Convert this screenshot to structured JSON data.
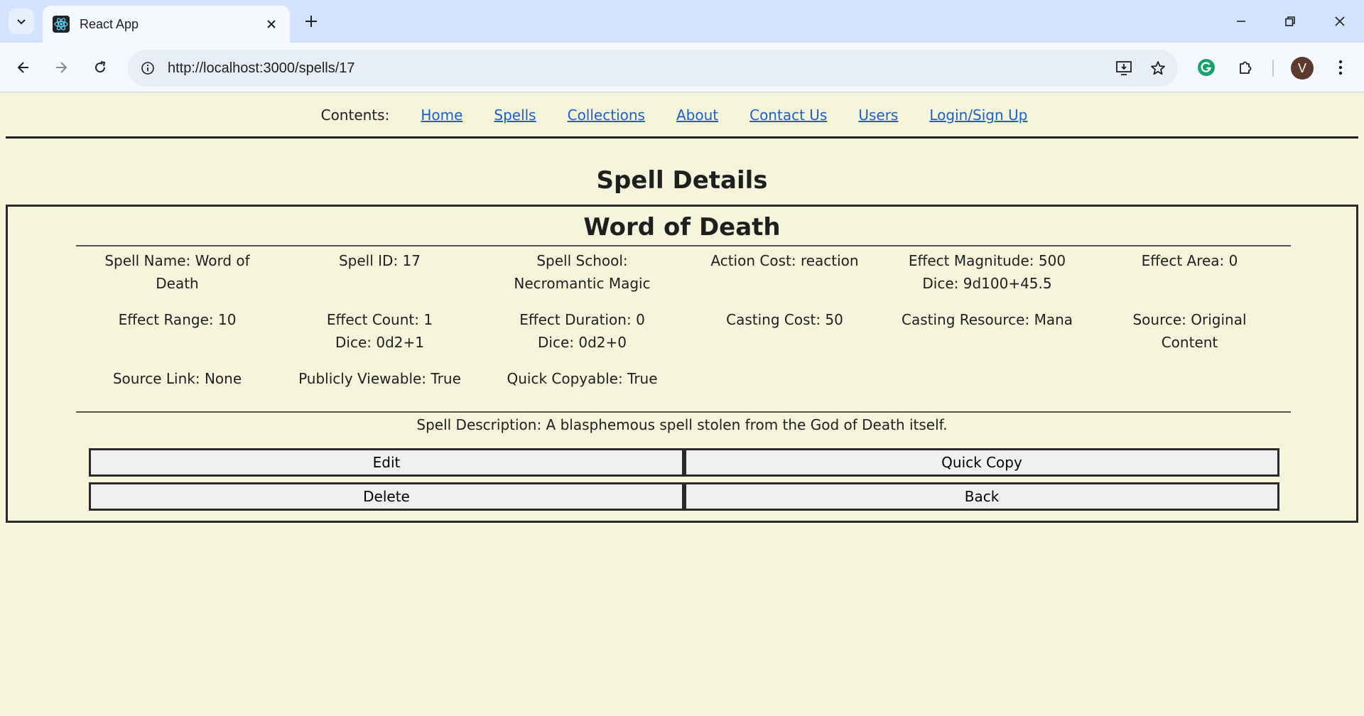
{
  "browser": {
    "tab_title": "React App",
    "url": "http://localhost:3000/spells/17",
    "avatar_letter": "V"
  },
  "nav": {
    "label": "Contents:",
    "links": [
      "Home",
      "Spells",
      "Collections",
      "About",
      "Contact Us",
      "Users",
      "Login/Sign Up"
    ]
  },
  "page_title": "Spell Details",
  "spell": {
    "title": "Word of Death",
    "fields": [
      [
        "Spell Name: Word of Death"
      ],
      [
        "Spell ID: 17"
      ],
      [
        "Spell School: Necromantic Magic"
      ],
      [
        "Action Cost: reaction"
      ],
      [
        "Effect Magnitude: 500",
        "Dice: 9d100+45.5"
      ],
      [
        "Effect Area: 0"
      ],
      [
        "Effect Range: 10"
      ],
      [
        "Effect Count: 1",
        "Dice: 0d2+1"
      ],
      [
        "Effect Duration: 0",
        "Dice: 0d2+0"
      ],
      [
        "Casting Cost: 50"
      ],
      [
        "Casting Resource: Mana"
      ],
      [
        "Source: Original Content"
      ],
      [
        "Source Link: None"
      ],
      [
        "Publicly Viewable: True"
      ],
      [
        "Quick Copyable: True"
      ]
    ],
    "description": "Spell Description: A blasphemous spell stolen from the God of Death itself."
  },
  "buttons": {
    "edit": "Edit",
    "quick_copy": "Quick Copy",
    "delete": "Delete",
    "back": "Back"
  }
}
